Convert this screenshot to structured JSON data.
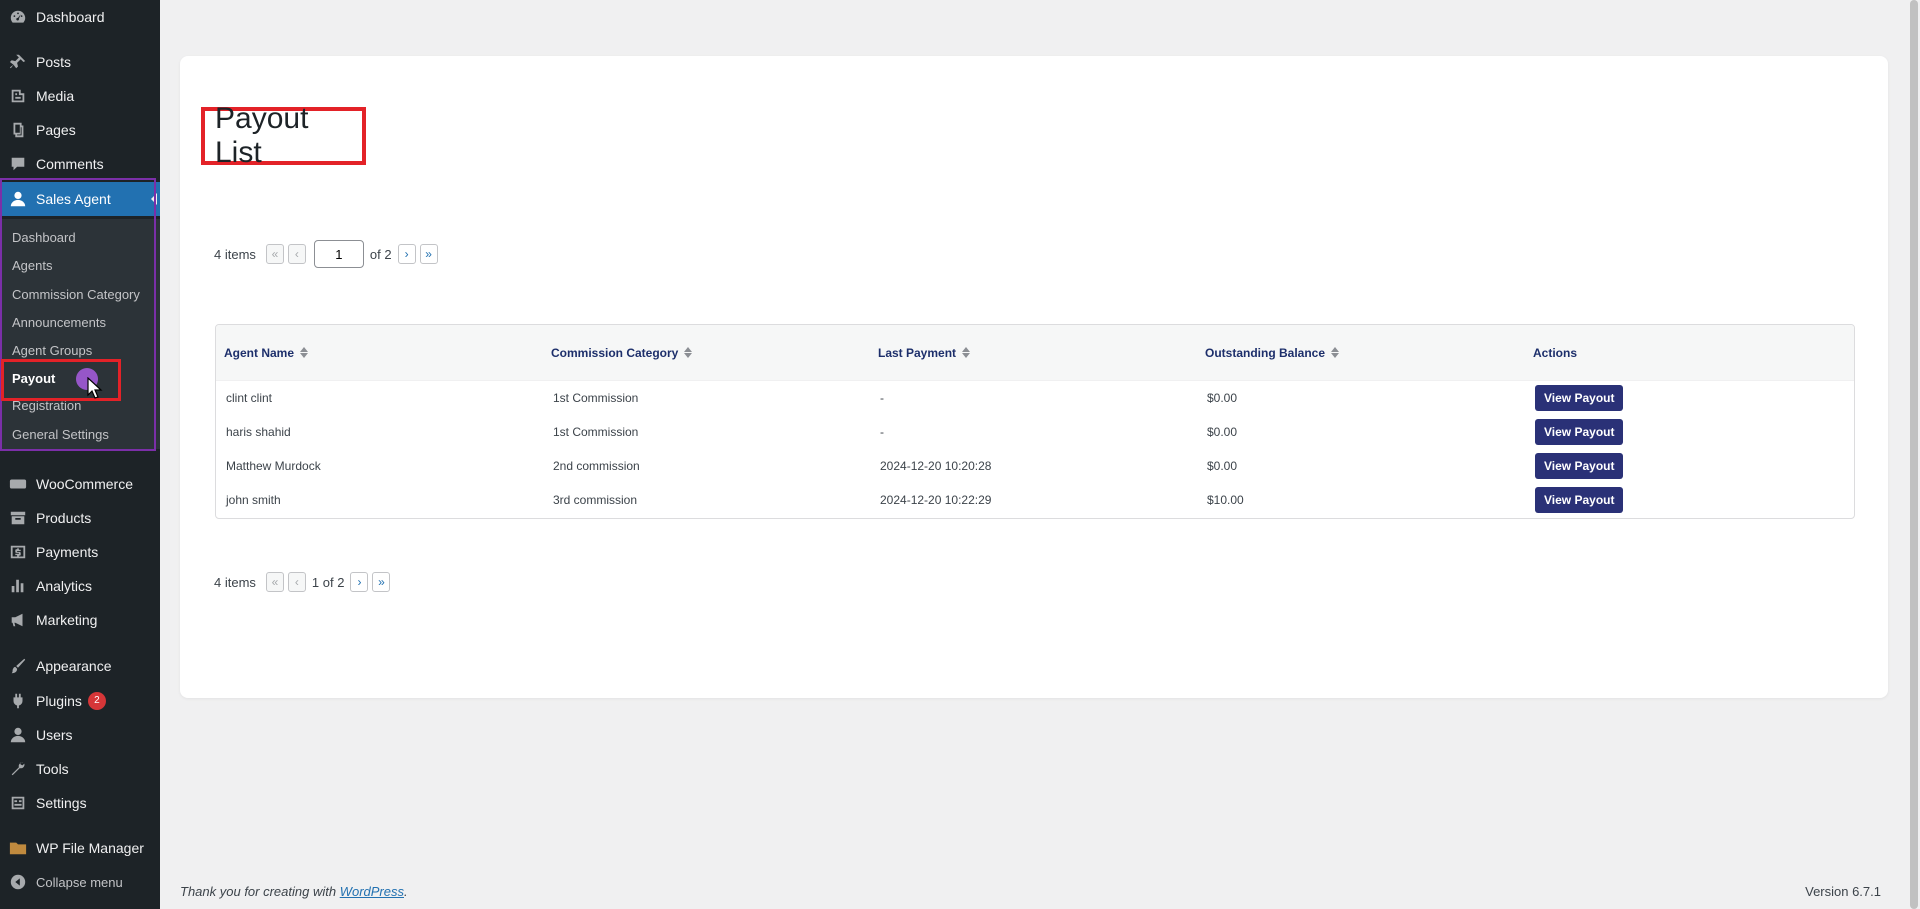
{
  "sidebar": {
    "items": [
      {
        "label": "Dashboard",
        "icon": "dashboard-icon"
      },
      {
        "label": "Posts",
        "icon": "pin-icon"
      },
      {
        "label": "Media",
        "icon": "media-icon"
      },
      {
        "label": "Pages",
        "icon": "pages-icon"
      },
      {
        "label": "Comments",
        "icon": "comment-icon"
      },
      {
        "label": "Sales Agent",
        "icon": "user-icon"
      },
      {
        "label": "WooCommerce",
        "icon": "woo-icon"
      },
      {
        "label": "Products",
        "icon": "archive-icon"
      },
      {
        "label": "Payments",
        "icon": "dollar-icon"
      },
      {
        "label": "Analytics",
        "icon": "bar-chart-icon"
      },
      {
        "label": "Marketing",
        "icon": "megaphone-icon"
      },
      {
        "label": "Appearance",
        "icon": "brush-icon"
      },
      {
        "label": "Plugins",
        "icon": "plugin-icon",
        "badge": "2"
      },
      {
        "label": "Users",
        "icon": "users-icon"
      },
      {
        "label": "Tools",
        "icon": "wrench-icon"
      },
      {
        "label": "Settings",
        "icon": "settings-icon"
      },
      {
        "label": "WP File Manager",
        "icon": "folder-icon"
      },
      {
        "label": "Collapse menu",
        "icon": "collapse-icon"
      }
    ],
    "submenu": [
      {
        "label": "Dashboard"
      },
      {
        "label": "Agents"
      },
      {
        "label": "Commission Category"
      },
      {
        "label": "Announcements"
      },
      {
        "label": "Agent Groups"
      },
      {
        "label": "Payout"
      },
      {
        "label": "Registration"
      },
      {
        "label": "General Settings"
      }
    ]
  },
  "page": {
    "title": "Payout List"
  },
  "pager_top": {
    "count": "4 items",
    "first": "«",
    "prev": "‹",
    "current": "1",
    "of": "of 2",
    "next": "›",
    "last": "»"
  },
  "pager_bottom": {
    "count": "4 items",
    "first": "«",
    "prev": "‹",
    "page_text": "1 of 2",
    "next": "›",
    "last": "»"
  },
  "table": {
    "headers": [
      "Agent Name",
      "Commission Category",
      "Last Payment",
      "Outstanding Balance",
      "Actions"
    ],
    "rows": [
      {
        "name": "clint clint",
        "category": "1st Commission",
        "last_payment": "-",
        "balance": "$0.00",
        "action": "View Payout"
      },
      {
        "name": "haris shahid",
        "category": "1st Commission",
        "last_payment": "-",
        "balance": "$0.00",
        "action": "View Payout"
      },
      {
        "name": "Matthew Murdock",
        "category": "2nd commission",
        "last_payment": "2024-12-20 10:20:28",
        "balance": "$0.00",
        "action": "View Payout"
      },
      {
        "name": "john smith",
        "category": "3rd commission",
        "last_payment": "2024-12-20 10:22:29",
        "balance": "$10.00",
        "action": "View Payout"
      }
    ]
  },
  "footer": {
    "thanks_prefix": "Thank you for creating with ",
    "wp_link": "WordPress",
    "thanks_suffix": ".",
    "version": "Version 6.7.1"
  },
  "colors": {
    "sidebar_bg": "#1d2327",
    "active_bg": "#2271b1",
    "button_bg": "#2a3177",
    "highlight": "#e32228"
  }
}
